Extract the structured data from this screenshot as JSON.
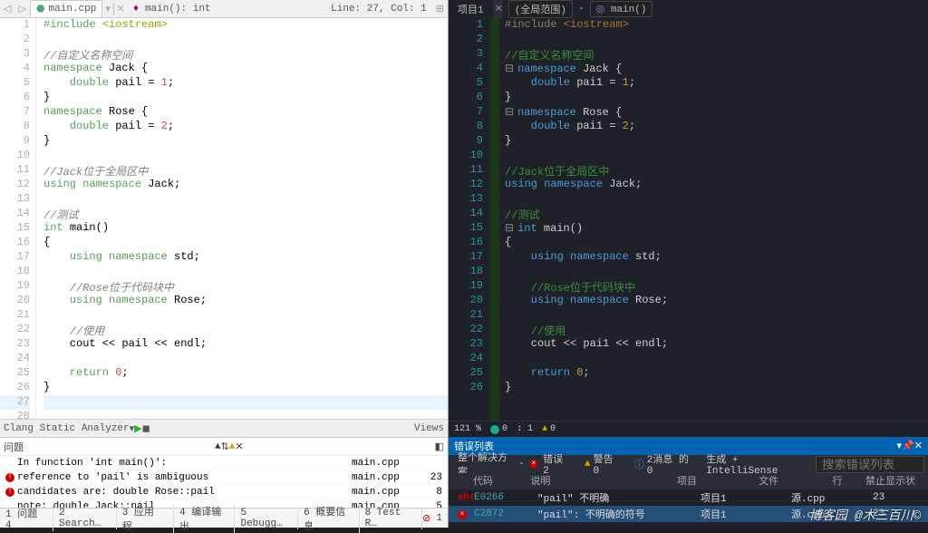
{
  "left": {
    "tab": "main.cpp",
    "crumb": "main(): int",
    "cursor": "Line: 27, Col: 1",
    "analyzer": "Clang Static Analyzer",
    "views": "Views",
    "problems_title": "问题",
    "problems": [
      {
        "msg": "In function 'int main()':",
        "file": "main.cpp",
        "line": ""
      },
      {
        "msg": "reference to 'pail' is ambiguous",
        "file": "main.cpp",
        "line": "23"
      },
      {
        "msg": "candidates are: double Rose::pail",
        "file": "main.cpp",
        "line": "8"
      },
      {
        "msg": "note:        double Jack::pail",
        "file": "main.cpp",
        "line": "5"
      }
    ],
    "status": [
      "1 问题 4",
      "2 Search…",
      "3 应用程…",
      "4 编译输出",
      "5 Debugg…",
      "6 概要信息",
      "8 Test R…"
    ],
    "err_count": "1"
  },
  "right": {
    "project_tab": "项目1",
    "scope": "(全局范围)",
    "func": "main()",
    "zoom": "121 %",
    "issue_summary": "0",
    "char_pos": "1",
    "errlist_title": "错误列表",
    "filter_solution": "整个解决方案",
    "filter_errors": "错误 2",
    "filter_warnings": "警告 0",
    "filter_messages": "2消息 的 0",
    "filter_build": "生成 + IntelliSense",
    "search_placeholder": "搜索错误列表",
    "cols": {
      "code": "代码",
      "desc": "说明",
      "proj": "项目",
      "file": "文件",
      "line": "行",
      "suppress": "禁止显示状态"
    },
    "errors": [
      {
        "code": "E0266",
        "desc": "\"pail\" 不明确",
        "proj": "项目1",
        "file": "源.cpp",
        "line": "23"
      },
      {
        "code": "C2872",
        "desc": "\"pail\": 不明确的符号",
        "proj": "项目1",
        "file": "源.cpp",
        "line": "23"
      }
    ]
  },
  "code": {
    "l1": "#include <iostream>",
    "l3": "//自定义名称空间",
    "l4a": "namespace",
    "l4b": " Jack {",
    "l5a": "    double",
    "l5b": " pail = ",
    "l5c": "1",
    "l5d": ";",
    "l6": "}",
    "l7a": "namespace",
    "l7b": " Rose {",
    "l8a": "    double",
    "l8b": " pail = ",
    "l8c": "2",
    "l8d": ";",
    "l9": "}",
    "l11": "//Jack位于全局区中",
    "l12a": "using namespace",
    "l12b": " Jack;",
    "l14": "//测试",
    "l15a": "int ",
    "l15b": "main",
    "l15c": "()",
    "l16": "{",
    "l17a": "    using namespace",
    "l17b": " std;",
    "l19": "    //Rose位于代码块中",
    "l20a": "    using namespace",
    "l20b": " Rose;",
    "l22": "    //使用",
    "l23": "    cout << pail << endl;",
    "l25a": "    return ",
    "l25b": "0",
    "l25c": ";",
    "l26": "}"
  },
  "rcode": {
    "l1": "#include <iostream>",
    "r5a": "    double",
    "r5b": " pai1 = ",
    "r5c": "1",
    "r5d": ";",
    "r8a": "    double",
    "r8b": " pai1 = ",
    "r8c": "2",
    "r8d": ";",
    "l12b": " Jack;",
    "l23": "    cout << pai1 << endl;"
  },
  "watermark": "博客园 @木三百川©"
}
